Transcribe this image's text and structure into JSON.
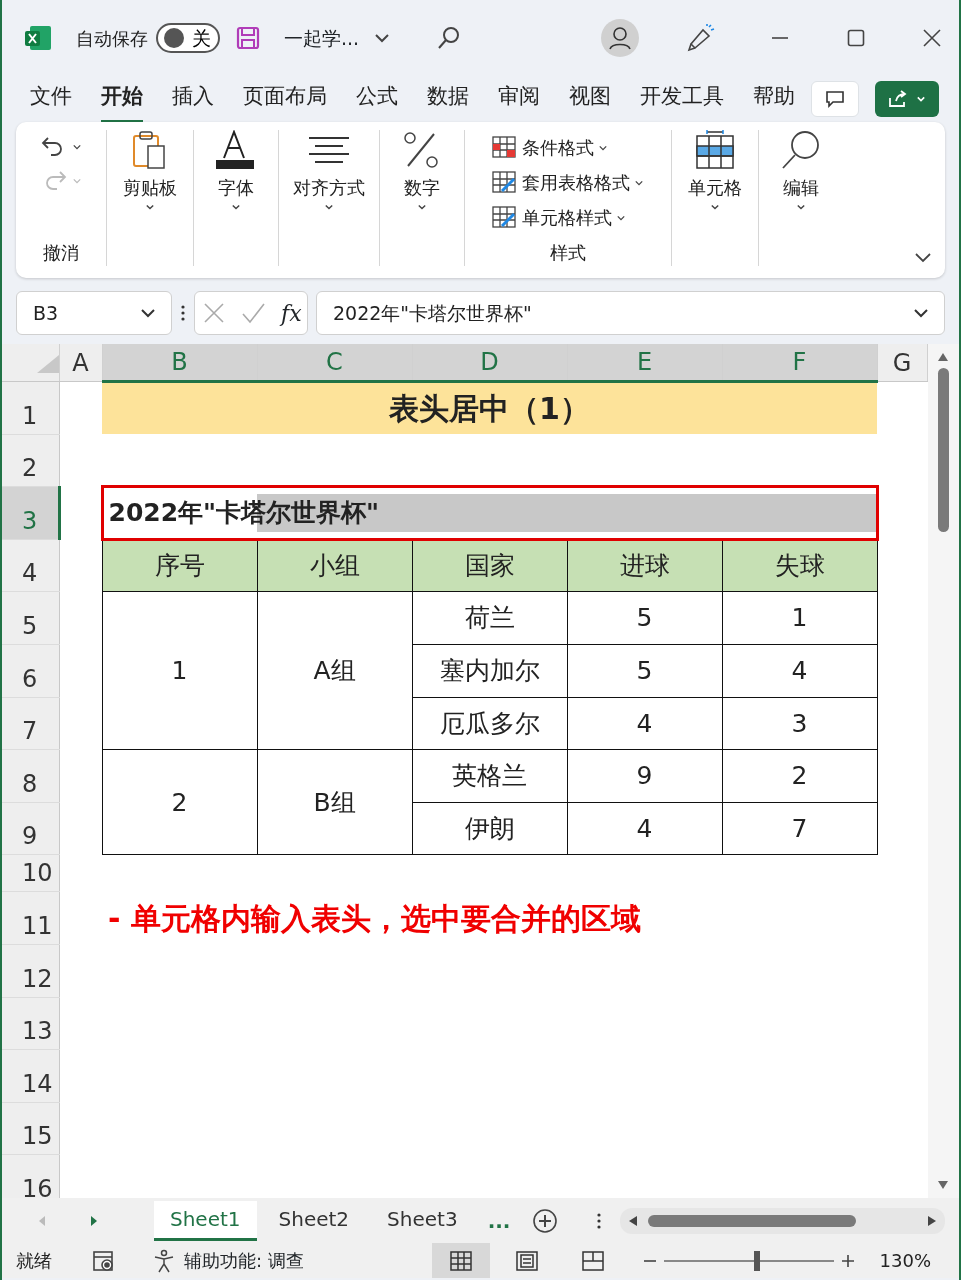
{
  "title_bar": {
    "autosave_label": "自动保存",
    "autosave": {
      "on": false,
      "label": "关"
    },
    "document_title": "一起学..."
  },
  "ribbon_tabs": [
    {
      "label": "文件",
      "selected": false
    },
    {
      "label": "开始",
      "selected": true
    },
    {
      "label": "插入",
      "selected": false
    },
    {
      "label": "页面布局",
      "selected": false
    },
    {
      "label": "公式",
      "selected": false
    },
    {
      "label": "数据",
      "selected": false
    },
    {
      "label": "审阅",
      "selected": false
    },
    {
      "label": "视图",
      "selected": false
    },
    {
      "label": "开发工具",
      "selected": false
    },
    {
      "label": "帮助",
      "selected": false
    }
  ],
  "ribbon_groups": [
    {
      "kind": "undo",
      "label": "撤消",
      "undo": {
        "disabled": false
      },
      "redo": {
        "disabled": true
      }
    },
    {
      "kind": "big",
      "label": "剪贴板"
    },
    {
      "kind": "big",
      "label": "字体"
    },
    {
      "kind": "big",
      "label": "对齐方式"
    },
    {
      "kind": "big",
      "label": "数字"
    },
    {
      "kind": "styles",
      "label": "样式",
      "items": [
        "条件格式",
        "套用表格格式",
        "单元格样式"
      ]
    },
    {
      "kind": "big",
      "label": "单元格"
    },
    {
      "kind": "big",
      "label": "编辑"
    }
  ],
  "formula_bar": {
    "name_box": "B3",
    "fx": "fx",
    "formula": "2022年\"卡塔尔世界杯\""
  },
  "sheet": {
    "columns": [
      {
        "label": "A",
        "selected": false
      },
      {
        "label": "B",
        "selected": true
      },
      {
        "label": "C",
        "selected": true
      },
      {
        "label": "D",
        "selected": true
      },
      {
        "label": "E",
        "selected": true
      },
      {
        "label": "F",
        "selected": true
      },
      {
        "label": "G",
        "selected": false
      }
    ],
    "rows": [
      {
        "label": "1",
        "selected": false
      },
      {
        "label": "2",
        "selected": false
      },
      {
        "label": "3",
        "selected": true
      },
      {
        "label": "4",
        "selected": false
      },
      {
        "label": "5",
        "selected": false
      },
      {
        "label": "6",
        "selected": false
      },
      {
        "label": "7",
        "selected": false
      },
      {
        "label": "8",
        "selected": false
      },
      {
        "label": "9",
        "selected": false
      },
      {
        "label": "10",
        "selected": false
      },
      {
        "label": "11",
        "selected": false
      },
      {
        "label": "12",
        "selected": false
      },
      {
        "label": "13",
        "selected": false
      },
      {
        "label": "14",
        "selected": false
      },
      {
        "label": "15",
        "selected": false
      },
      {
        "label": "16",
        "selected": false
      }
    ],
    "title": "表头居中（1）",
    "header_text": "2022年\"卡塔尔世界杯\"",
    "table": {
      "columns": [
        "序号",
        "小组",
        "国家",
        "进球",
        "失球"
      ],
      "groups": [
        {
          "number": "1",
          "group": "A组",
          "teams": [
            {
              "country": "荷兰",
              "goals_for": "5",
              "goals_against": "1"
            },
            {
              "country": "塞内加尔",
              "goals_for": "5",
              "goals_against": "4"
            },
            {
              "country": "厄瓜多尔",
              "goals_for": "4",
              "goals_against": "3"
            }
          ]
        },
        {
          "number": "2",
          "group": "B组",
          "teams": [
            {
              "country": "英格兰",
              "goals_for": "9",
              "goals_against": "2"
            },
            {
              "country": "伊朗",
              "goals_for": "4",
              "goals_against": "7"
            }
          ]
        }
      ]
    },
    "note": "- 单元格内输入表头，选中要合并的区域"
  },
  "sheet_tabs": [
    {
      "label": "Sheet1",
      "selected": true
    },
    {
      "label": "Sheet2",
      "selected": false
    },
    {
      "label": "Sheet3",
      "selected": false
    }
  ],
  "more_sheets": "...",
  "status_bar": {
    "ready": "就绪",
    "accessibility": "辅助功能: 调查",
    "views": [
      {
        "kind": "normal",
        "selected": true
      },
      {
        "kind": "page_layout",
        "selected": false
      },
      {
        "kind": "page_break",
        "selected": false
      }
    ],
    "zoom": {
      "level": 0.55,
      "label": "130%"
    }
  }
}
